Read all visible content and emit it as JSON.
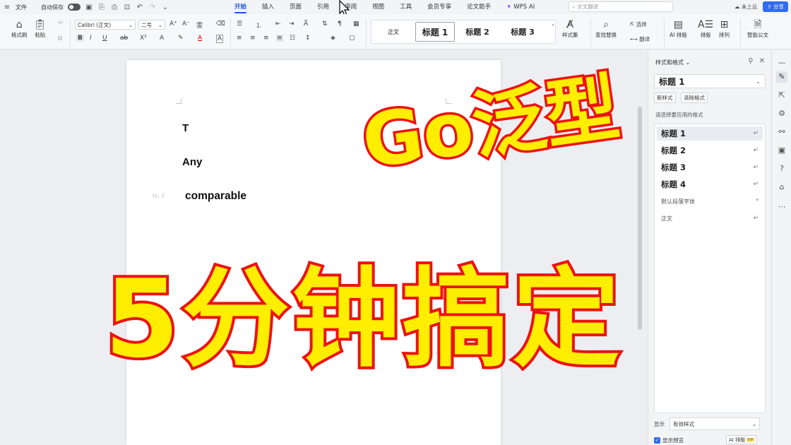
{
  "topbar": {
    "file_label": "文件",
    "autosave_label": "自动保存",
    "tabs": [
      "开始",
      "插入",
      "页面",
      "引用",
      "审阅",
      "视图",
      "工具",
      "会员专享",
      "论文助手",
      "WPS AI"
    ],
    "active_tab": "开始",
    "search_placeholder": "全文翻译",
    "cloud_label": "未上云",
    "share_label": "分享"
  },
  "ribbon": {
    "format_painter": "格式刷",
    "paste": "粘贴",
    "font_family": "Calibri (正文)",
    "font_size": "二号",
    "style_normal": "正文",
    "style_h1": "标题 1",
    "style_h2": "标题 2",
    "style_h3": "标题 3",
    "style_set": "样式集",
    "find_replace": "查找替换",
    "select": "选择",
    "translate": "翻译",
    "ai_layout": "AI 排版",
    "layout": "排版",
    "arrange": "排列",
    "smart_doc": "智能公文"
  },
  "document": {
    "line1": "T",
    "line2": "Any",
    "line3": "comparable",
    "heading_marker": "H₃"
  },
  "panel": {
    "title": "样式和格式",
    "current_style": "标题 1",
    "new_style": "新样式",
    "clear_format": "清除格式",
    "subtitle": "请选择要应用的格式",
    "styles": [
      {
        "label": "标题 1",
        "kind": "big",
        "mark": "↵"
      },
      {
        "label": "标题 2",
        "kind": "big",
        "mark": "↵"
      },
      {
        "label": "标题 3",
        "kind": "big",
        "mark": "↵"
      },
      {
        "label": "标题 4",
        "kind": "big",
        "mark": "↵"
      },
      {
        "label": "默认段落字体",
        "kind": "small",
        "mark": "ᵃ"
      },
      {
        "label": "正文",
        "kind": "small",
        "mark": "↵"
      }
    ],
    "show_label": "显示",
    "show_value": "有效样式",
    "preview_label": "显示预览",
    "ai_layout": "AI 排版",
    "vip": "VIP"
  },
  "overlay": {
    "top": "Go泛型",
    "bottom": "5分钟搞定"
  },
  "colors": {
    "accent": "#1a56d6",
    "overlay_fill": "#ffee00",
    "overlay_stroke": "#ee1111"
  }
}
